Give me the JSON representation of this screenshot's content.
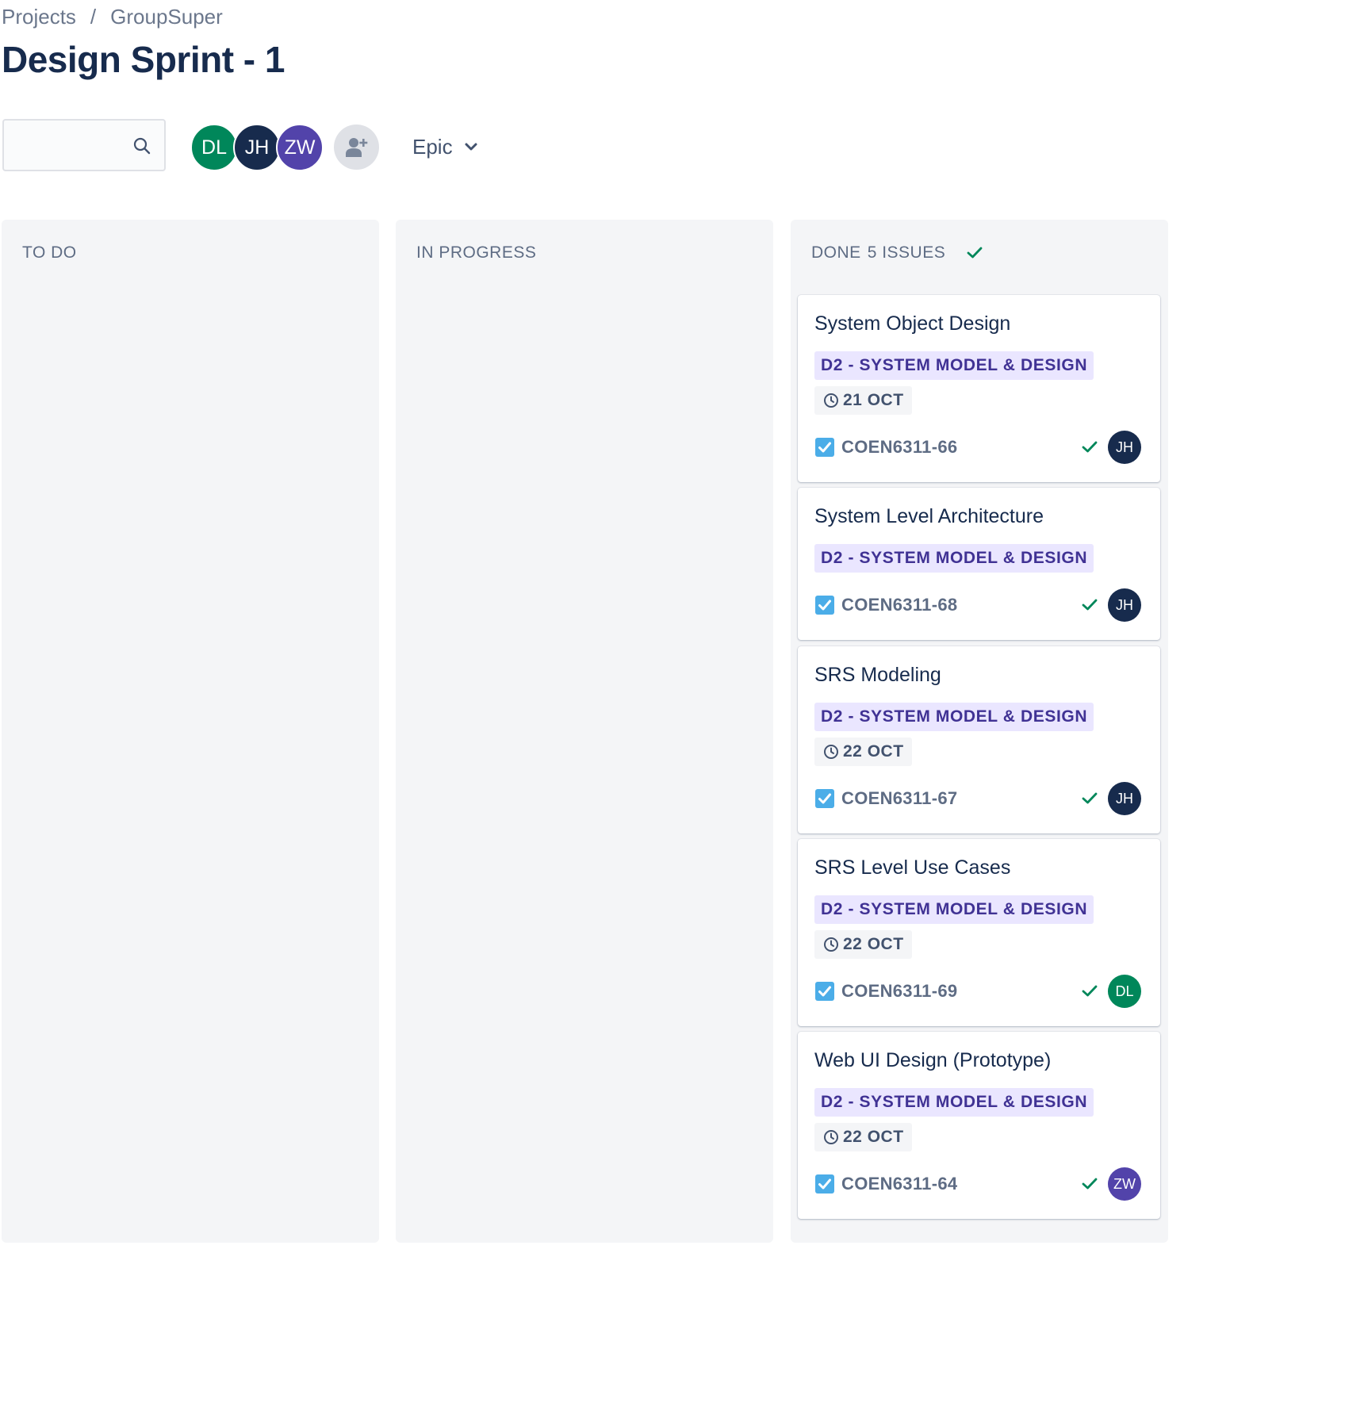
{
  "breadcrumb": {
    "items": [
      "Projects",
      "GroupSuper"
    ],
    "separator": "/"
  },
  "page_title": "Design Sprint - 1",
  "toolbar": {
    "search_placeholder": "",
    "avatars": [
      "DL",
      "JH",
      "ZW"
    ],
    "epic_label": "Epic"
  },
  "columns": {
    "todo": {
      "label": "TO DO"
    },
    "in_progress": {
      "label": "IN PROGRESS"
    },
    "done": {
      "label": "DONE",
      "count_label": "5 ISSUES"
    }
  },
  "cards": [
    {
      "title": "System Object Design",
      "epic": "D2 - SYSTEM MODEL & DESIGN",
      "due": "21 OCT",
      "key": "COEN6311-66",
      "assignee": "JH"
    },
    {
      "title": "System Level Architecture",
      "epic": "D2 - SYSTEM MODEL & DESIGN",
      "due": null,
      "key": "COEN6311-68",
      "assignee": "JH"
    },
    {
      "title": "SRS Modeling",
      "epic": "D2 - SYSTEM MODEL & DESIGN",
      "due": "22 OCT",
      "key": "COEN6311-67",
      "assignee": "JH"
    },
    {
      "title": "SRS Level Use Cases",
      "epic": "D2 - SYSTEM MODEL & DESIGN",
      "due": "22 OCT",
      "key": "COEN6311-69",
      "assignee": "DL"
    },
    {
      "title": "Web UI Design (Prototype)",
      "epic": "D2 - SYSTEM MODEL & DESIGN",
      "due": "22 OCT",
      "key": "COEN6311-64",
      "assignee": "ZW"
    }
  ],
  "colors": {
    "DL": "#00875a",
    "JH": "#172b4d",
    "ZW": "#5243aa",
    "epic_bg": "#eae6ff",
    "epic_fg": "#403294",
    "done_green": "#00875a",
    "task_blue": "#4bade8"
  },
  "icons": {
    "search": "search-icon",
    "add_user": "add-user-icon",
    "chevron": "chevron-down-icon",
    "done_check": "check-icon",
    "task": "task-checkbox-icon",
    "due": "clock-icon"
  }
}
